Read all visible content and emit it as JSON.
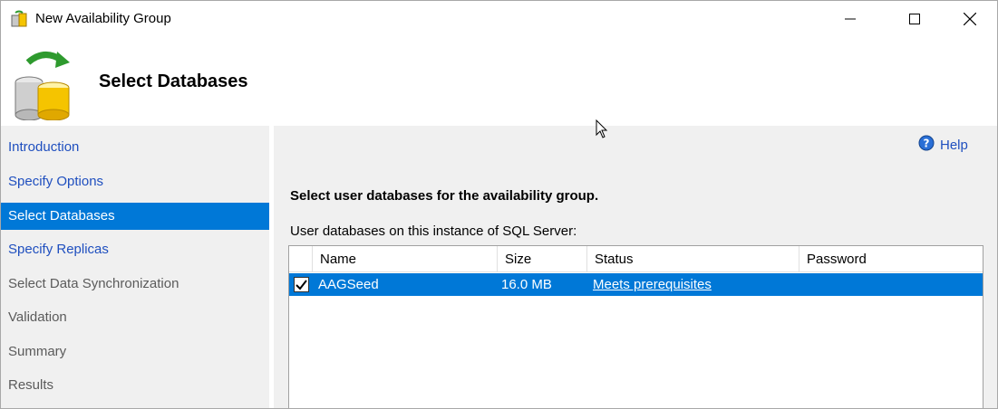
{
  "window": {
    "title": "New Availability Group"
  },
  "header": {
    "title": "Select Databases"
  },
  "nav": {
    "items": [
      {
        "label": "Introduction",
        "state": "link"
      },
      {
        "label": "Specify Options",
        "state": "link"
      },
      {
        "label": "Select Databases",
        "state": "selected"
      },
      {
        "label": "Specify Replicas",
        "state": "link"
      },
      {
        "label": "Select Data Synchronization",
        "state": "disabled"
      },
      {
        "label": "Validation",
        "state": "disabled"
      },
      {
        "label": "Summary",
        "state": "disabled"
      },
      {
        "label": "Results",
        "state": "disabled"
      }
    ]
  },
  "main": {
    "help_label": "Help",
    "instruction": "Select user databases for the availability group.",
    "grid_label": "User databases on this instance of SQL Server:",
    "columns": [
      "Name",
      "Size",
      "Status",
      "Password"
    ],
    "rows": [
      {
        "checked": true,
        "name": "AAGSeed",
        "size": "16.0 MB",
        "status": "Meets prerequisites",
        "password": ""
      }
    ]
  },
  "colors": {
    "selection": "#0078d7",
    "link": "#1f4fbf",
    "panel": "#f0f0f0"
  }
}
